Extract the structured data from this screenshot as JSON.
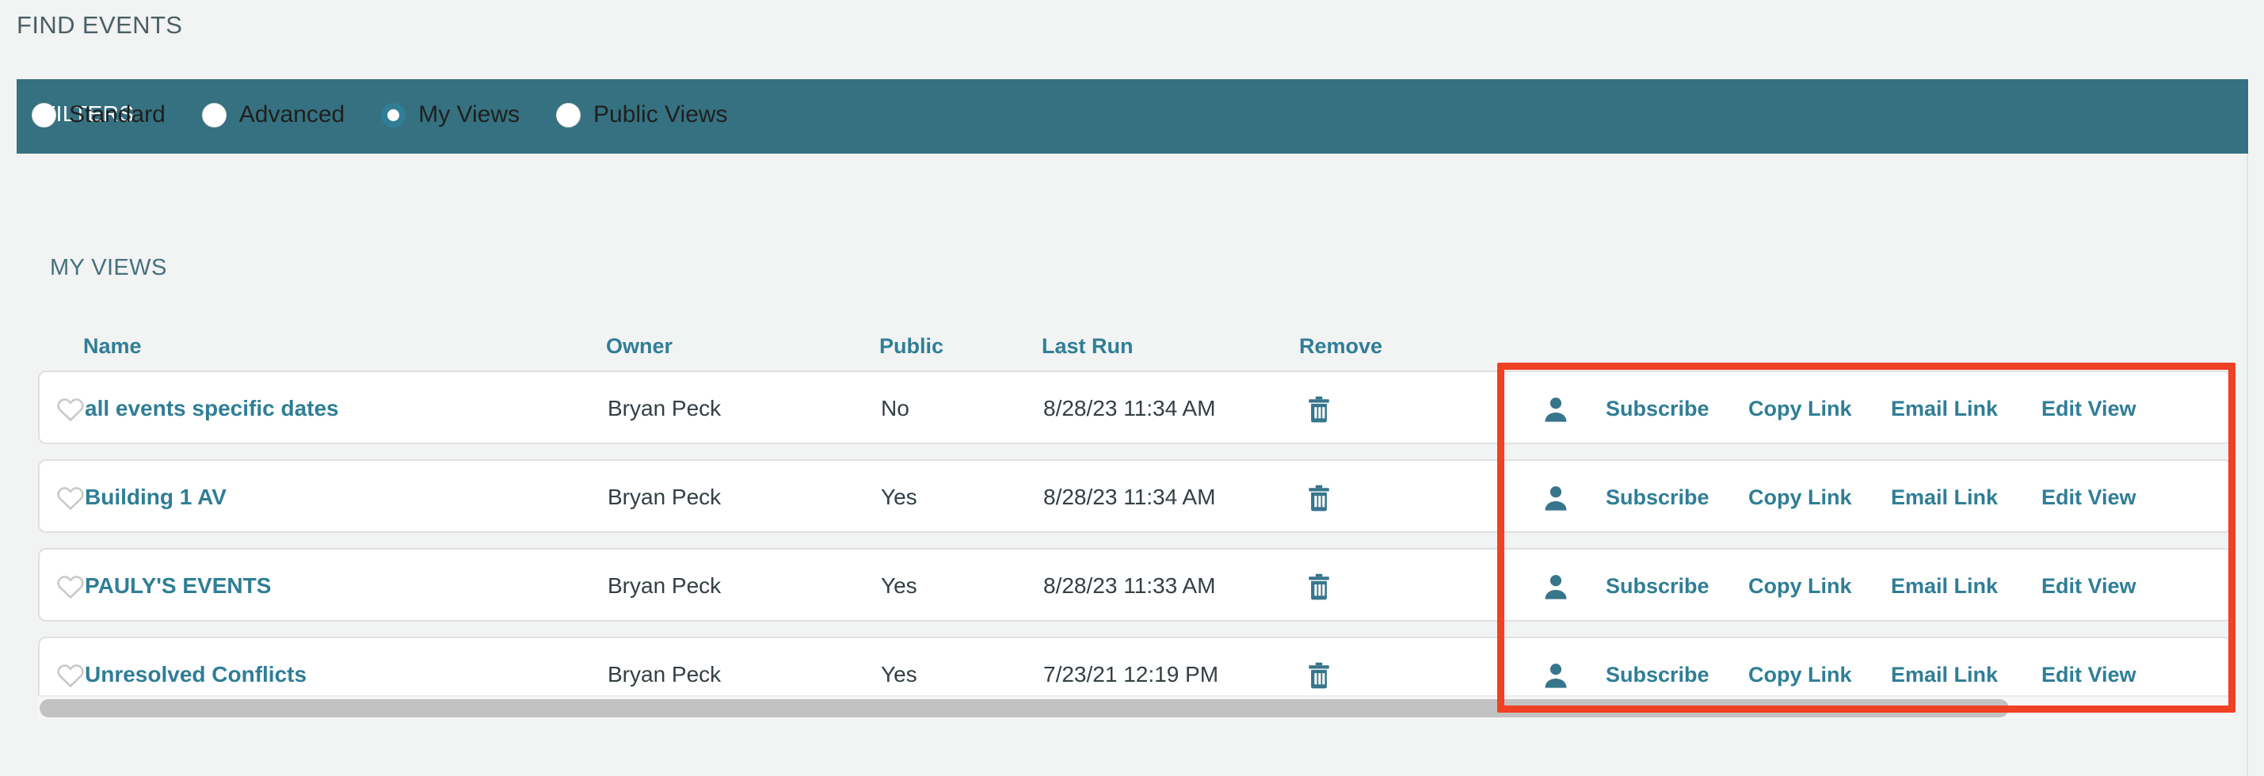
{
  "page": {
    "title": "FIND EVENTS"
  },
  "filters": {
    "bar_label": "FILTERS",
    "options": [
      {
        "label": "Standard",
        "selected": false
      },
      {
        "label": "Advanced",
        "selected": false
      },
      {
        "label": "My Views",
        "selected": true
      },
      {
        "label": "Public Views",
        "selected": false
      }
    ]
  },
  "my_views": {
    "heading": "MY VIEWS",
    "columns": [
      "Name",
      "Owner",
      "Public",
      "Last Run",
      "Remove"
    ],
    "rows": [
      {
        "name": "all events specific dates",
        "owner": "Bryan Peck",
        "public": "No",
        "last_run": "8/28/23 11:34 AM",
        "favorite_icon": "heart-outline-icon",
        "remove_icon": "trash-icon",
        "actions": [
          "Subscribe",
          "Copy Link",
          "Email Link",
          "Edit View"
        ]
      },
      {
        "name": "Building 1 AV",
        "owner": "Bryan Peck",
        "public": "Yes",
        "last_run": "8/28/23 11:34 AM",
        "favorite_icon": "heart-outline-icon",
        "remove_icon": "trash-icon",
        "actions": [
          "Subscribe",
          "Copy Link",
          "Email Link",
          "Edit View"
        ]
      },
      {
        "name": "PAULY'S EVENTS",
        "owner": "Bryan Peck",
        "public": "Yes",
        "last_run": "8/28/23 11:33 AM",
        "favorite_icon": "heart-outline-icon",
        "remove_icon": "trash-icon",
        "actions": [
          "Subscribe",
          "Copy Link",
          "Email Link",
          "Edit View"
        ]
      },
      {
        "name": "Unresolved Conflicts",
        "owner": "Bryan Peck",
        "public": "Yes",
        "last_run": "7/23/21 12:19 PM",
        "favorite_icon": "heart-outline-icon",
        "remove_icon": "trash-icon",
        "actions": [
          "Subscribe",
          "Copy Link",
          "Email Link",
          "Edit View"
        ]
      }
    ],
    "person_icon": "person-icon"
  },
  "colors": {
    "teal_bar": "#357180",
    "teal_text": "#2f7e96",
    "title_text": "#4a5f66",
    "highlight_red": "#ef4123",
    "page_bg": "#f2f3f3",
    "row_bg": "#ffffff",
    "heart_gray": "#c8c8c8",
    "scroll_thumb": "#c2c2c2"
  },
  "annotation": {
    "highlight_label": "red-highlight-box"
  }
}
